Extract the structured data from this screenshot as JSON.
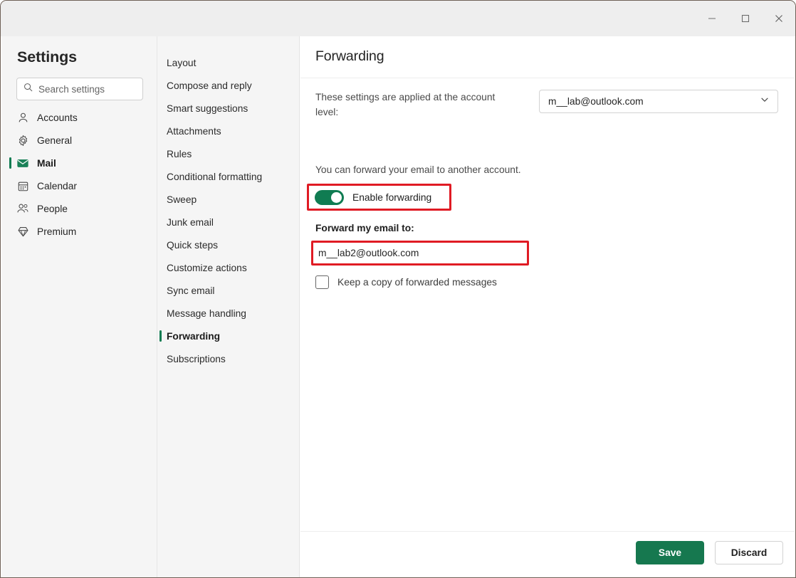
{
  "window": {
    "controls": [
      {
        "name": "minimize-button",
        "icon": "minimize-icon",
        "label": "Minimize"
      },
      {
        "name": "maximize-button",
        "icon": "maximize-icon",
        "label": "Maximize"
      },
      {
        "name": "close-button",
        "icon": "close-icon",
        "label": "Close"
      }
    ]
  },
  "sidebar": {
    "title": "Settings",
    "search": {
      "placeholder": "Search settings",
      "value": "",
      "icon": "search-icon"
    },
    "items": [
      {
        "label": "Accounts",
        "icon": "person-icon",
        "active": false
      },
      {
        "label": "General",
        "icon": "gear-icon",
        "active": false
      },
      {
        "label": "Mail",
        "icon": "mail-icon",
        "active": true
      },
      {
        "label": "Calendar",
        "icon": "calendar-icon",
        "active": false
      },
      {
        "label": "People",
        "icon": "people-icon",
        "active": false
      },
      {
        "label": "Premium",
        "icon": "diamond-icon",
        "active": false
      }
    ]
  },
  "subnav": {
    "items": [
      {
        "label": "Layout",
        "active": false
      },
      {
        "label": "Compose and reply",
        "active": false
      },
      {
        "label": "Smart suggestions",
        "active": false
      },
      {
        "label": "Attachments",
        "active": false
      },
      {
        "label": "Rules",
        "active": false
      },
      {
        "label": "Conditional formatting",
        "active": false
      },
      {
        "label": "Sweep",
        "active": false
      },
      {
        "label": "Junk email",
        "active": false
      },
      {
        "label": "Quick steps",
        "active": false
      },
      {
        "label": "Customize actions",
        "active": false
      },
      {
        "label": "Sync email",
        "active": false
      },
      {
        "label": "Message handling",
        "active": false
      },
      {
        "label": "Forwarding",
        "active": true
      },
      {
        "label": "Subscriptions",
        "active": false
      }
    ]
  },
  "main": {
    "title": "Forwarding",
    "account_label": "These settings are applied at the account level:",
    "account_select": {
      "value": "m__lab@outlook.com",
      "icon": "chevron-down-icon"
    },
    "description": "You can forward your email to another account.",
    "toggle": {
      "label": "Enable forwarding",
      "state": "on"
    },
    "forward_field": {
      "label": "Forward my email to:",
      "value": "m__lab2@outlook.com",
      "placeholder": ""
    },
    "checkbox": {
      "label": "Keep a copy of forwarded messages",
      "checked": false
    }
  },
  "footer": {
    "save_label": "Save",
    "discard_label": "Discard"
  },
  "colors": {
    "accent_green": "#107c52",
    "save_green": "#16784f",
    "highlight_red": "#e01b24",
    "titlebar_bg": "#eeeeee",
    "sidebar_bg": "#f5f5f5",
    "content_bg": "#ffffff"
  }
}
